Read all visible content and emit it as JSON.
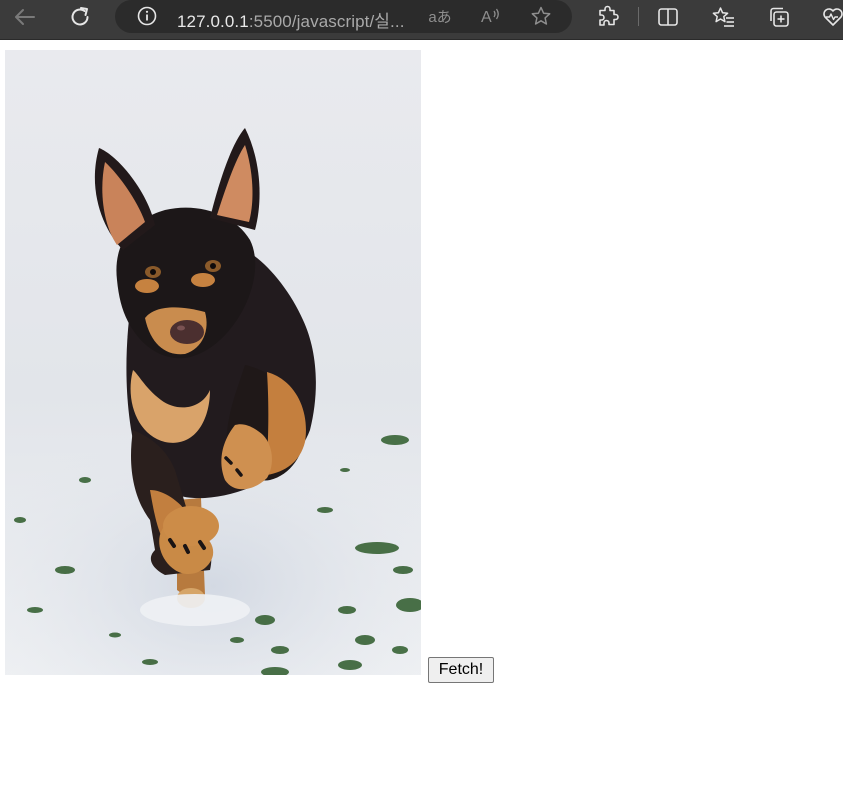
{
  "browser": {
    "url_host": "127.0.0.1",
    "url_rest": ":5500/javascript/실...",
    "read_mode_label": "aあ",
    "read_aloud_label": "A",
    "icons": {
      "back": "back-arrow-icon",
      "reload": "reload-icon",
      "info": "info-icon",
      "favorite": "star-icon",
      "extensions": "puzzle-icon",
      "split": "split-screen-icon",
      "favorites": "favorites-icon",
      "collections": "collections-icon",
      "health": "browser-essentials-icon"
    }
  },
  "page": {
    "image_subject": "dog running in snow",
    "fetch_button_label": "Fetch!"
  },
  "colors": {
    "toolbar": "#3b3b3b",
    "addressbar": "#2b2b2b",
    "url_host": "#e8e8e8",
    "url_path": "#a9a9a9"
  }
}
